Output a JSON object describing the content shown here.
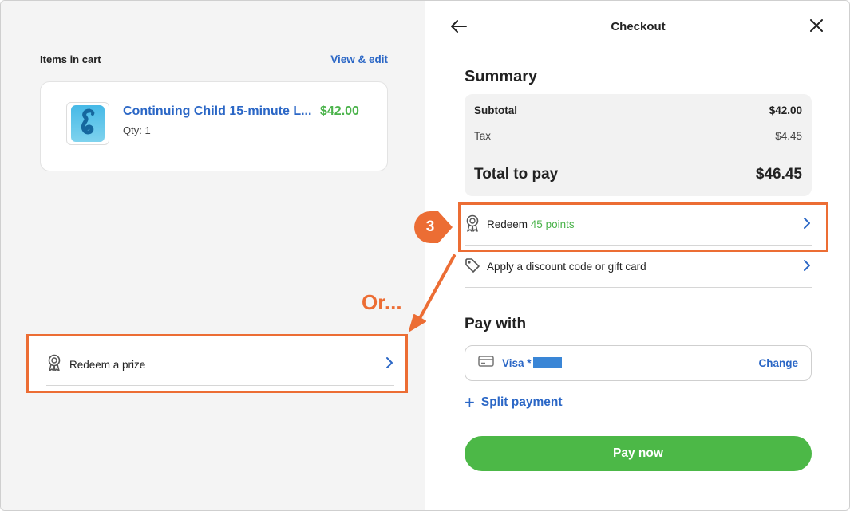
{
  "cart": {
    "title": "Items in cart",
    "view_edit": "View & edit",
    "item": {
      "name": "Continuing Child 15-minute L...",
      "price": "$42.00",
      "qty": "Qty: 1",
      "icon": "seahorse-logo-icon"
    }
  },
  "annotation": {
    "or_label": "Or...",
    "step_number": "3",
    "color": "#ec6d34"
  },
  "prize": {
    "label": "Redeem a prize",
    "icon": "award-ribbon-icon"
  },
  "checkout": {
    "title": "Checkout",
    "back_icon": "arrow-left-icon",
    "close_icon": "close-icon"
  },
  "summary": {
    "title": "Summary",
    "subtotal_label": "Subtotal",
    "subtotal_value": "$42.00",
    "tax_label": "Tax",
    "tax_value": "$4.45",
    "total_label": "Total to pay",
    "total_value": "$46.45"
  },
  "options": {
    "redeem_prefix": "Redeem",
    "redeem_points": "45 points",
    "discount_label": "Apply a discount code or gift card"
  },
  "payment": {
    "title": "Pay with",
    "card_label": "Visa *",
    "change_label": "Change",
    "split_label": "Split payment",
    "pay_button": "Pay now"
  },
  "colors": {
    "accent_blue": "#2b67c6",
    "accent_green": "#4cb847",
    "annotation_orange": "#ec6d34"
  }
}
